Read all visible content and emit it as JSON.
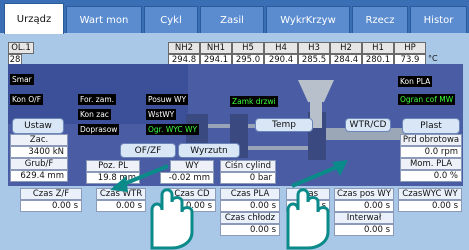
{
  "tabs": [
    "Urządz",
    "Wart mon",
    "Cykl",
    "Zasil",
    "WykrKrzyw",
    "Rzecz",
    "Histor"
  ],
  "ol_label": "OL.1",
  "ol_value": "28",
  "heaters": {
    "headers": [
      "NH2",
      "NH1",
      "H5",
      "H4",
      "H3",
      "H2",
      "H1",
      "HP"
    ],
    "values": [
      "294.8",
      "294.1",
      "295.0",
      "290.4",
      "285.5",
      "284.4",
      "280.1",
      "73.9"
    ],
    "unit": "°C"
  },
  "status_left": [
    "Smar",
    "Kon O/F"
  ],
  "status_mid": [
    "For. zam.",
    "Kon zac",
    "Doprasow"
  ],
  "status_mid2": [
    "Posuw WY",
    "WstWY",
    "Ogr. WYC WY"
  ],
  "status_zamek": "Zamk drzwi",
  "status_right": [
    "Kon PLA",
    "Ogran cof MW"
  ],
  "buttons": {
    "ustaw": "Ustaw",
    "ofzf": "OF/ZF",
    "wyrzutn": "Wyrzutn",
    "temp": "Temp",
    "wtrcd": "WTR/CD",
    "plast": "Plast"
  },
  "left_fields": {
    "zac_label": "Zac.",
    "zac_value": "3400 kN",
    "grub_label": "Grub/F",
    "grub_value": "629.4 mm"
  },
  "mid_fields": {
    "poz_label": "Poz. PL",
    "poz_value": "19.8 mm",
    "wy_label": "WY",
    "wy_value": "-0.02 mm"
  },
  "cisn": {
    "label": "Ciśn cylind",
    "value": "0 bar"
  },
  "right_fields": {
    "prd_label": "Prd obrotowa",
    "prd_value": "0.0 rpm",
    "mom_label": "Mom. PLA",
    "mom_value": "0.0 %"
  },
  "bottom": {
    "row1_labels": [
      "Czas Z/F",
      "Czas WTR",
      "Czas CD",
      "Czas PLA",
      "Czas",
      "Czas pos WY",
      "CzasWYC WY"
    ],
    "row1_values": [
      "0.00 s",
      "0.00 s",
      "0.00 s",
      "0.00 s",
      "0.00 s",
      "0.00 s",
      "0.00 s"
    ],
    "chlodz_label": "Czas chłodz",
    "chlodz_value": "0.00 s",
    "interwal_label": "Interwał",
    "interwal_value": "0.00 s"
  }
}
